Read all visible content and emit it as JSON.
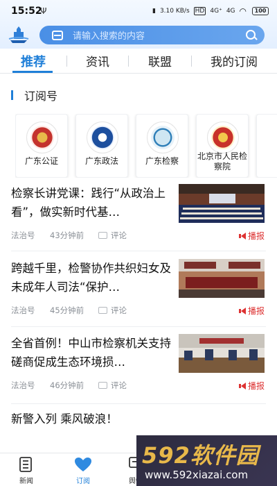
{
  "status": {
    "time": "15:52",
    "usb": "Ψ",
    "net": "3.10 KB/s",
    "hd": "HD",
    "sig1": "4G⁺",
    "sig2": "4G",
    "battery": "100"
  },
  "search": {
    "placeholder": "请输入搜索的内容"
  },
  "tabs": [
    {
      "label": "推荐",
      "active": true
    },
    {
      "label": "资讯"
    },
    {
      "label": "联盟"
    },
    {
      "label": "我的订阅"
    }
  ],
  "subscriptions": {
    "title": "订阅号",
    "items": [
      {
        "name": "广东公证",
        "emblem_color": "#c4322d",
        "emblem_bg": "#fde9e5"
      },
      {
        "name": "广东政法",
        "emblem_color": "#1d4f9e",
        "emblem_bg": "#e5edfb"
      },
      {
        "name": "广东检察",
        "emblem_color": "#2f7fb8",
        "emblem_bg": "#e6f1f8"
      },
      {
        "name": "北京市人民检察院",
        "emblem_color": "#c8322a",
        "emblem_bg": "#fff2cc"
      }
    ]
  },
  "articles": [
    {
      "title": "检察长讲党课：践行“从政治上看”，做实新时代基…",
      "source": "法治号",
      "time": "43分钟前",
      "comment": "评论",
      "report": "播报"
    },
    {
      "title": "跨越千里，检警协作共织妇女及未成年人司法“保护…",
      "source": "法治号",
      "time": "45分钟前",
      "comment": "评论",
      "report": "播报"
    },
    {
      "title": "全省首例！中山市检察机关支持磋商促成生态环境损…",
      "source": "法治号",
      "time": "46分钟前",
      "comment": "评论",
      "report": "播报"
    },
    {
      "title": "新警入列 乘风破浪！"
    }
  ],
  "bottom_nav": [
    {
      "label": "新闻"
    },
    {
      "label": "订阅",
      "active": true
    },
    {
      "label": "舆情"
    }
  ],
  "watermark": {
    "brand": "592软件园",
    "url": "www.592xiazai.com"
  },
  "colors": {
    "accent": "#1f7fd8",
    "report": "#dd3333"
  }
}
